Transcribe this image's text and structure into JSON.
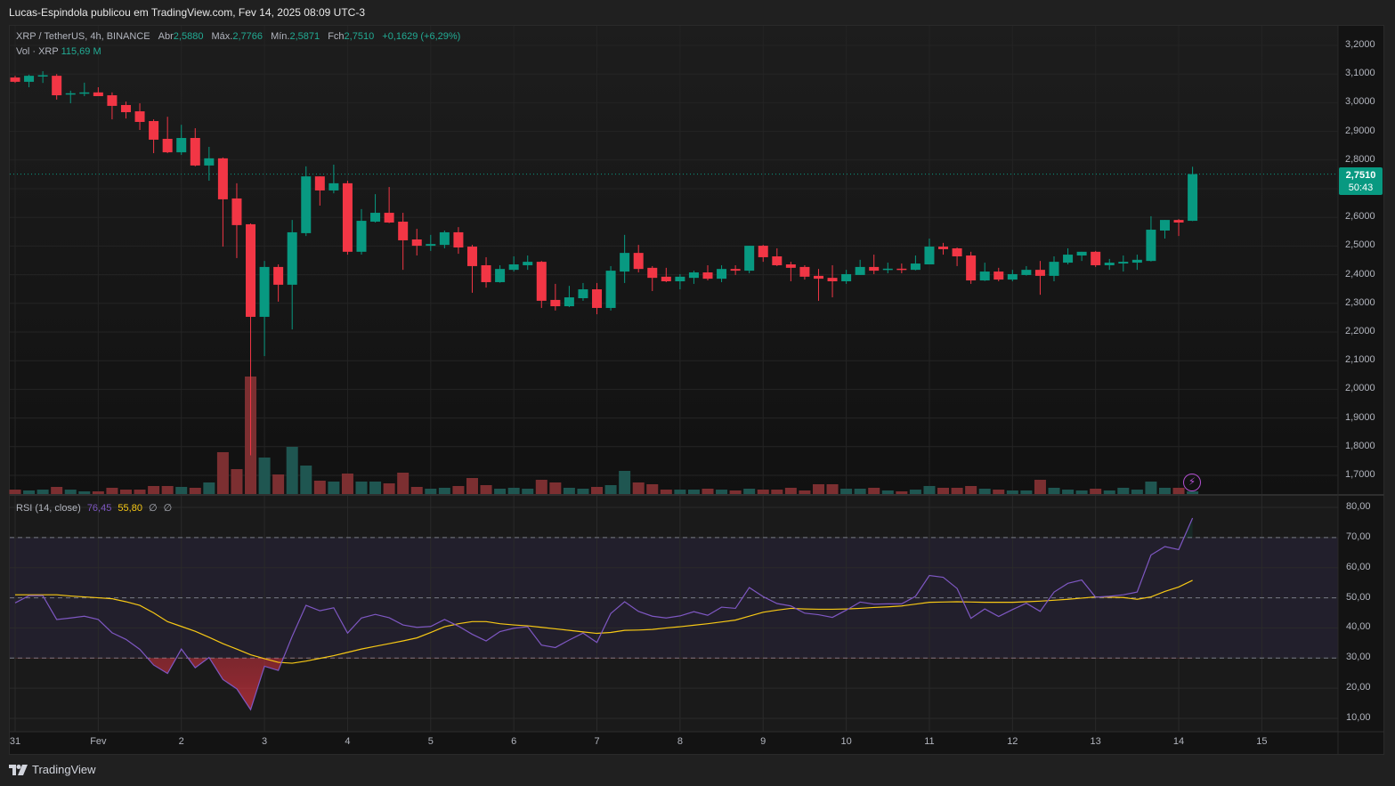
{
  "header": {
    "title": "Lucas-Espindola publicou em TradingView.com, Fev 14, 2025 08:09 UTC-3"
  },
  "legend": {
    "symbol": "XRP / TetherUS, 4h, BINANCE",
    "open_label": "Abr",
    "open": "2,5880",
    "high_label": "Máx.",
    "high": "2,7766",
    "low_label": "Mín.",
    "low": "2,5871",
    "close_label": "Fch",
    "close": "2,7510",
    "change": "+0,1629 (+6,29%)",
    "vol_label": "Vol · XRP",
    "vol": "115,69 M"
  },
  "rsi_legend": {
    "label": "RSI (14, close)",
    "rsi": "76,45",
    "ma": "55,80",
    "extra1": "∅",
    "extra2": "∅"
  },
  "last_price": {
    "price": "2,7510",
    "countdown": "50:43"
  },
  "brand": {
    "name": "TradingView"
  },
  "colors": {
    "up": "#089981",
    "down": "#f23645",
    "vol_up": "#1f5651",
    "vol_down": "#7c2f31",
    "rsi": "#7e57c2",
    "rsi_ma": "#f7c815",
    "alert": "#b24fd1"
  },
  "chart_data": {
    "type": "candlestick",
    "symbol": "XRP/USDT",
    "interval": "4h",
    "price_axis_labels": [
      "3,2000",
      "3,1000",
      "3,0000",
      "2,9000",
      "2,8000",
      "2,7000",
      "2,6000",
      "2,5000",
      "2,4000",
      "2,3000",
      "2,2000",
      "2,1000",
      "2,0000",
      "1,9000",
      "1,8000",
      "1,7000"
    ],
    "price_axis_values": [
      3.2,
      3.1,
      3.0,
      2.9,
      2.8,
      2.7,
      2.6,
      2.5,
      2.4,
      2.3,
      2.2,
      2.1,
      2.0,
      1.9,
      1.8,
      1.7
    ],
    "rsi_axis_labels": [
      "80,00",
      "70,00",
      "60,00",
      "50,00",
      "40,00",
      "30,00",
      "20,00",
      "10,00"
    ],
    "rsi_axis_values": [
      80,
      70,
      60,
      50,
      40,
      30,
      20,
      10
    ],
    "rsi_bands": [
      70,
      50,
      30
    ],
    "date_labels": [
      {
        "label": "31",
        "index": 0
      },
      {
        "label": "Fev",
        "index": 6
      },
      {
        "label": "2",
        "index": 12
      },
      {
        "label": "3",
        "index": 18
      },
      {
        "label": "4",
        "index": 24
      },
      {
        "label": "5",
        "index": 30
      },
      {
        "label": "6",
        "index": 36
      },
      {
        "label": "7",
        "index": 42
      },
      {
        "label": "8",
        "index": 48
      },
      {
        "label": "9",
        "index": 54
      },
      {
        "label": "10",
        "index": 60
      },
      {
        "label": "11",
        "index": 66
      },
      {
        "label": "12",
        "index": 72
      },
      {
        "label": "13",
        "index": 78
      },
      {
        "label": "14",
        "index": 84
      },
      {
        "label": "15",
        "index": 90
      }
    ],
    "ohlc": [
      [
        3.088,
        3.094,
        3.069,
        3.073
      ],
      [
        3.073,
        3.098,
        3.054,
        3.094
      ],
      [
        3.094,
        3.11,
        3.069,
        3.096
      ],
      [
        3.094,
        3.1,
        3.011,
        3.026
      ],
      [
        3.03,
        3.042,
        2.998,
        3.033
      ],
      [
        3.033,
        3.07,
        3.023,
        3.036
      ],
      [
        3.036,
        3.054,
        3.023,
        3.023
      ],
      [
        3.026,
        3.036,
        2.942,
        2.989
      ],
      [
        2.992,
        3.004,
        2.945,
        2.967
      ],
      [
        2.97,
        2.998,
        2.905,
        2.933
      ],
      [
        2.936,
        2.942,
        2.824,
        2.871
      ],
      [
        2.874,
        2.951,
        2.824,
        2.827
      ],
      [
        2.827,
        2.923,
        2.818,
        2.877
      ],
      [
        2.877,
        2.911,
        2.778,
        2.781
      ],
      [
        2.781,
        2.846,
        2.728,
        2.806
      ],
      [
        2.806,
        2.809,
        2.498,
        2.663
      ],
      [
        2.666,
        2.719,
        2.458,
        2.573
      ],
      [
        2.576,
        2.579,
        1.77,
        2.253
      ],
      [
        2.253,
        2.448,
        2.116,
        2.427
      ],
      [
        2.427,
        2.436,
        2.306,
        2.365
      ],
      [
        2.365,
        2.591,
        2.209,
        2.548
      ],
      [
        2.545,
        2.778,
        2.535,
        2.743
      ],
      [
        2.743,
        2.743,
        2.641,
        2.694
      ],
      [
        2.694,
        2.784,
        2.684,
        2.719
      ],
      [
        2.719,
        2.728,
        2.47,
        2.48
      ],
      [
        2.48,
        2.629,
        2.47,
        2.588
      ],
      [
        2.585,
        2.681,
        2.582,
        2.616
      ],
      [
        2.616,
        2.706,
        2.58,
        2.582
      ],
      [
        2.585,
        2.616,
        2.417,
        2.52
      ],
      [
        2.523,
        2.56,
        2.467,
        2.501
      ],
      [
        2.501,
        2.539,
        2.483,
        2.507
      ],
      [
        2.504,
        2.554,
        2.492,
        2.548
      ],
      [
        2.548,
        2.566,
        2.473,
        2.495
      ],
      [
        2.498,
        2.504,
        2.337,
        2.43
      ],
      [
        2.433,
        2.461,
        2.355,
        2.374
      ],
      [
        2.374,
        2.433,
        2.372,
        2.42
      ],
      [
        2.417,
        2.464,
        2.411,
        2.436
      ],
      [
        2.433,
        2.467,
        2.417,
        2.445
      ],
      [
        2.445,
        2.448,
        2.284,
        2.309
      ],
      [
        2.312,
        2.368,
        2.275,
        2.29
      ],
      [
        2.29,
        2.361,
        2.287,
        2.321
      ],
      [
        2.318,
        2.371,
        2.309,
        2.349
      ],
      [
        2.349,
        2.371,
        2.262,
        2.284
      ],
      [
        2.284,
        2.43,
        2.275,
        2.414
      ],
      [
        2.411,
        2.539,
        2.371,
        2.476
      ],
      [
        2.476,
        2.504,
        2.408,
        2.42
      ],
      [
        2.424,
        2.43,
        2.343,
        2.389
      ],
      [
        2.393,
        2.424,
        2.374,
        2.377
      ],
      [
        2.377,
        2.402,
        2.349,
        2.393
      ],
      [
        2.389,
        2.414,
        2.368,
        2.408
      ],
      [
        2.408,
        2.433,
        2.38,
        2.386
      ],
      [
        2.386,
        2.433,
        2.374,
        2.42
      ],
      [
        2.42,
        2.433,
        2.399,
        2.414
      ],
      [
        2.414,
        2.501,
        2.405,
        2.501
      ],
      [
        2.501,
        2.504,
        2.445,
        2.461
      ],
      [
        2.464,
        2.492,
        2.43,
        2.433
      ],
      [
        2.436,
        2.445,
        2.377,
        2.424
      ],
      [
        2.427,
        2.433,
        2.383,
        2.393
      ],
      [
        2.396,
        2.42,
        2.309,
        2.386
      ],
      [
        2.389,
        2.433,
        2.321,
        2.377
      ],
      [
        2.377,
        2.417,
        2.368,
        2.402
      ],
      [
        2.399,
        2.452,
        2.399,
        2.427
      ],
      [
        2.427,
        2.47,
        2.402,
        2.414
      ],
      [
        2.418,
        2.442,
        2.405,
        2.421
      ],
      [
        2.421,
        2.439,
        2.405,
        2.418
      ],
      [
        2.417,
        2.467,
        2.415,
        2.439
      ],
      [
        2.436,
        2.526,
        2.436,
        2.498
      ],
      [
        2.498,
        2.511,
        2.47,
        2.489
      ],
      [
        2.492,
        2.495,
        2.43,
        2.464
      ],
      [
        2.467,
        2.48,
        2.368,
        2.38
      ],
      [
        2.38,
        2.442,
        2.378,
        2.411
      ],
      [
        2.411,
        2.424,
        2.377,
        2.383
      ],
      [
        2.383,
        2.417,
        2.377,
        2.402
      ],
      [
        2.399,
        2.43,
        2.397,
        2.417
      ],
      [
        2.417,
        2.448,
        2.33,
        2.396
      ],
      [
        2.396,
        2.464,
        2.377,
        2.445
      ],
      [
        2.442,
        2.492,
        2.436,
        2.47
      ],
      [
        2.467,
        2.48,
        2.448,
        2.48
      ],
      [
        2.48,
        2.483,
        2.427,
        2.433
      ],
      [
        2.433,
        2.455,
        2.417,
        2.442
      ],
      [
        2.439,
        2.467,
        2.411,
        2.445
      ],
      [
        2.442,
        2.47,
        2.417,
        2.452
      ],
      [
        2.448,
        2.604,
        2.446,
        2.557
      ],
      [
        2.554,
        2.591,
        2.526,
        2.591
      ],
      [
        2.591,
        2.594,
        2.535,
        2.582
      ],
      [
        2.588,
        2.7766,
        2.5871,
        2.751
      ]
    ],
    "volume_millions": [
      192,
      154,
      192,
      308,
      192,
      116,
      116,
      270,
      192,
      192,
      347,
      347,
      308,
      270,
      501,
      1810,
      1078,
      5082,
      1579,
      847,
      2041,
      1232,
      578,
      539,
      886,
      539,
      539,
      462,
      924,
      308,
      231,
      270,
      347,
      693,
      385,
      231,
      270,
      231,
      616,
      501,
      270,
      231,
      308,
      385,
      1001,
      501,
      424,
      192,
      192,
      192,
      231,
      192,
      154,
      231,
      192,
      192,
      270,
      154,
      424,
      424,
      231,
      231,
      270,
      154,
      116,
      192,
      347,
      270,
      270,
      347,
      231,
      192,
      154,
      154,
      616,
      270,
      192,
      154,
      231,
      154,
      270,
      192,
      539,
      270,
      270,
      115.69
    ],
    "rsi": [
      48.3,
      50.7,
      50.7,
      42.8,
      43.3,
      43.9,
      42.8,
      38.4,
      36.2,
      32.9,
      27.7,
      24.9,
      33.0,
      26.8,
      30.2,
      22.9,
      19.8,
      12.9,
      27.3,
      25.9,
      37.2,
      47.5,
      45.7,
      46.7,
      38.3,
      43.3,
      44.5,
      43.4,
      41.0,
      40.2,
      40.5,
      42.8,
      40.6,
      37.9,
      35.7,
      38.8,
      39.9,
      40.4,
      34.3,
      33.5,
      36.0,
      38.3,
      35.2,
      44.8,
      48.7,
      45.5,
      43.9,
      43.3,
      44.0,
      45.4,
      44.2,
      46.9,
      46.5,
      53.4,
      50.4,
      48.1,
      47.3,
      44.9,
      44.4,
      43.5,
      45.9,
      48.6,
      47.9,
      48.0,
      48.0,
      50.5,
      57.4,
      56.8,
      53.1,
      43.2,
      46.3,
      43.8,
      46.1,
      48.2,
      45.5,
      51.9,
      54.8,
      55.9,
      50.2,
      50.5,
      51.0,
      51.9,
      64.2,
      67.0,
      66.0,
      76.45
    ],
    "rsi_ma": [
      51,
      51,
      51,
      51,
      50.6,
      50.3,
      50.0,
      49.7,
      48.7,
      47.5,
      45,
      42.1,
      40.5,
      38.9,
      36.9,
      34.8,
      33,
      31.1,
      29.8,
      28.6,
      28.3,
      29.0,
      29.9,
      30.8,
      31.9,
      33.0,
      33.9,
      34.8,
      35.7,
      36.7,
      38.5,
      40.4,
      41.4,
      42.1,
      42.1,
      41.4,
      41.0,
      40.7,
      40.2,
      39.7,
      39.2,
      38.7,
      38.2,
      38.5,
      39.2,
      39.3,
      39.5,
      40.0,
      40.4,
      40.9,
      41.4,
      42.0,
      42.6,
      43.9,
      45.2,
      45.9,
      46.5,
      46.3,
      46.2,
      46.2,
      46.3,
      46.5,
      46.8,
      47.0,
      47.3,
      47.9,
      48.5,
      48.6,
      48.7,
      48.6,
      48.5,
      48.5,
      48.5,
      48.7,
      48.9,
      49.2,
      49.5,
      49.9,
      50.3,
      50.2,
      50.1,
      49.5,
      50.3,
      52.1,
      53.6,
      55.8
    ],
    "last_close": 2.751
  }
}
